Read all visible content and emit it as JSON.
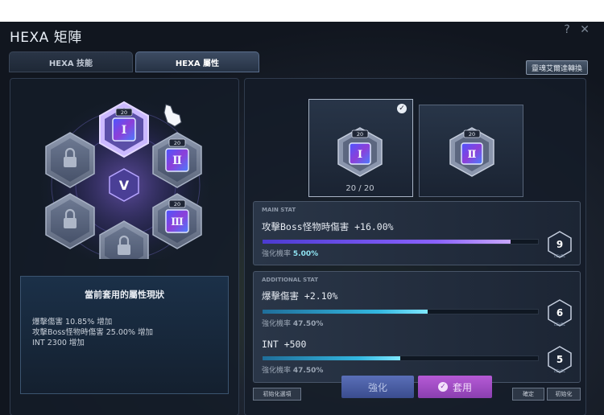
{
  "window": {
    "title": "HEXA 矩陣",
    "help_icon": "?",
    "close_icon": "✕"
  },
  "tabs": [
    {
      "label": "HEXA 技能",
      "active": false
    },
    {
      "label": "HEXA 屬性",
      "active": true
    }
  ],
  "convert_button": "靈魂艾爾達轉換",
  "board": {
    "slot_level": "20",
    "center_symbol": "V"
  },
  "status": {
    "title": "當前套用的屬性現狀",
    "lines": [
      "爆擊傷害 10.85% 增加",
      "攻擊Boss怪物時傷害 25.00% 增加",
      "INT 2300 增加"
    ]
  },
  "cards": {
    "card1_level": "20",
    "card1_count": "20 / 20",
    "card2_level": "20",
    "selected_check": "✓"
  },
  "main_stat": {
    "caption": "MAIN STAT",
    "name": "攻擊Boss怪物時傷害 +16.00%",
    "rate_label": "強化機率",
    "rate_value": "5.00%",
    "progress": 0.9,
    "level": "9",
    "level_caption": "LEVEL"
  },
  "additional_stat": {
    "caption": "ADDITIONAL STAT",
    "items": [
      {
        "name": "爆擊傷害 +2.10%",
        "rate_label": "強化機率",
        "rate_value": "47.50%",
        "progress": 0.6,
        "level": "6",
        "level_caption": "LEVEL"
      },
      {
        "name": "INT +500",
        "rate_label": "強化機率",
        "rate_value": "47.50%",
        "progress": 0.5,
        "level": "5",
        "level_caption": "LEVEL"
      }
    ]
  },
  "buttons": {
    "enhance": "強化",
    "apply": "套用",
    "reset": "初始化選項",
    "apply_icon": "✓",
    "right1": "確定",
    "right2": "初始化"
  },
  "colors": {
    "accent_purple": "#8a62ff",
    "accent_cyan": "#33b7e0",
    "apply_button": "#b65ad6",
    "enhance_button": "#5a6fb8"
  }
}
